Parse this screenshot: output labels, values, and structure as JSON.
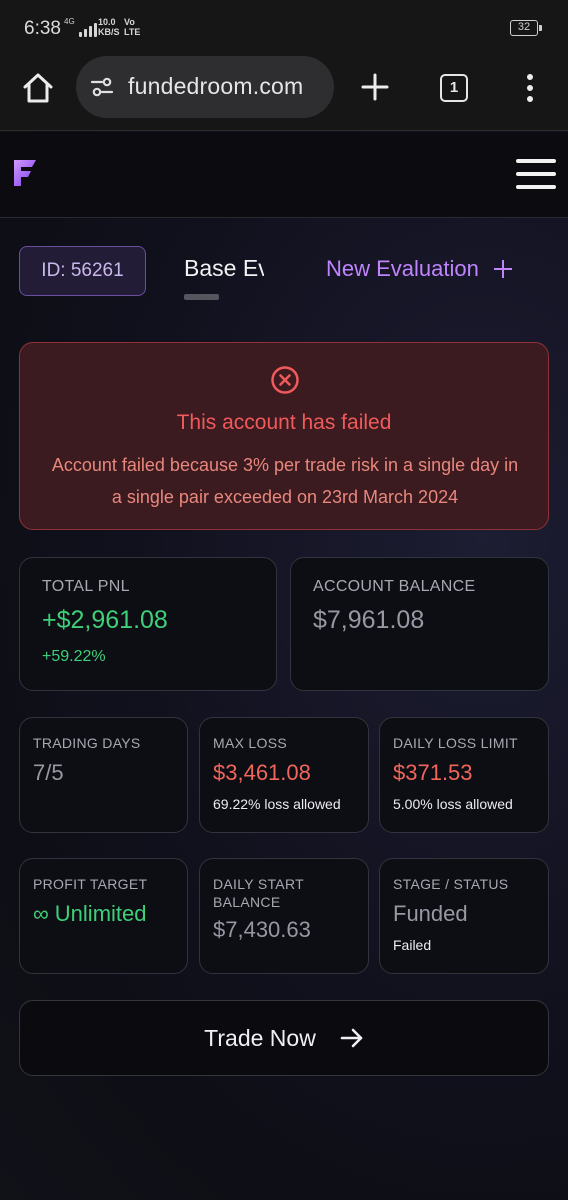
{
  "status_bar": {
    "time": "6:38",
    "network_label": "4G",
    "speed_value": "10.0",
    "speed_unit": "KB/S",
    "volte_top": "Vo",
    "volte_bottom": "LTE",
    "battery": "32"
  },
  "browser": {
    "url": "fundedroom.com",
    "tab_count": "1",
    "icons": [
      "home-icon",
      "site-settings-icon",
      "plus-icon",
      "tabs-icon",
      "more-vert-icon"
    ]
  },
  "site_header": {
    "logo_icon": "fundedroom-logo",
    "menu_icon": "hamburger-icon"
  },
  "account_row": {
    "id_label": "ID: 56261",
    "active_tab": "Base Evaluation",
    "new_evaluation_label": "New Evaluation"
  },
  "alert": {
    "title": "This account has failed",
    "message": "Account failed because 3% per trade risk in a single day in a single pair exceeded on 23rd March 2024",
    "icon": "x-circle-icon"
  },
  "stats": {
    "total_pnl": {
      "label": "TOTAL PNL",
      "value": "+$2,961.08",
      "sub": "+59.22%"
    },
    "account_balance": {
      "label": "ACCOUNT BALANCE",
      "value": "$7,961.08"
    },
    "trading_days": {
      "label": "TRADING DAYS",
      "value": "7/5"
    },
    "max_loss": {
      "label": "MAX LOSS",
      "value": "$3,461.08",
      "sub": "69.22% loss allowed"
    },
    "daily_loss_limit": {
      "label": "DAILY LOSS LIMIT",
      "value": "$371.53",
      "sub": "5.00% loss allowed"
    },
    "profit_target": {
      "label": "PROFIT TARGET",
      "value": "∞ Unlimited"
    },
    "daily_start_balance": {
      "label": "DAILY START BALANCE",
      "value": "$7,430.63"
    },
    "stage_status": {
      "label": "STAGE / STATUS",
      "value": "Funded",
      "sub": "Failed"
    }
  },
  "trade_button": {
    "label": "Trade Now"
  },
  "colors": {
    "accent_purple": "#c084fc",
    "positive_green": "#3ecf78",
    "negative_red": "#f0665a",
    "alert_bg": "#3b1a20"
  }
}
